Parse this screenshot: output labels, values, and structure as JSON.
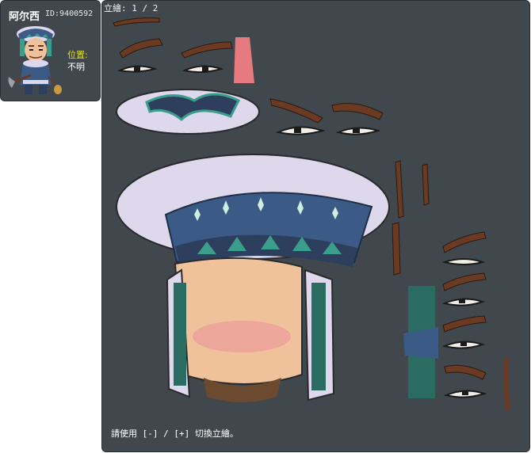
{
  "npc": {
    "name": "阿尔西",
    "id_text": "ID:9400592",
    "location_label": "位置:",
    "location_value": "不明"
  },
  "viewer": {
    "page_counter": "立繪: 1 / 2",
    "hint_text": "請使用 [-] / [+] 切換立繪。"
  },
  "colors": {
    "panel_bg": "#40474d",
    "hat_blue": "#3c5a86",
    "trim_teal": "#3a9e8a",
    "fur": "#ddd8ec",
    "skin": "#f0c29c",
    "brow": "#6b3a22",
    "location_label": "#e6e600"
  }
}
